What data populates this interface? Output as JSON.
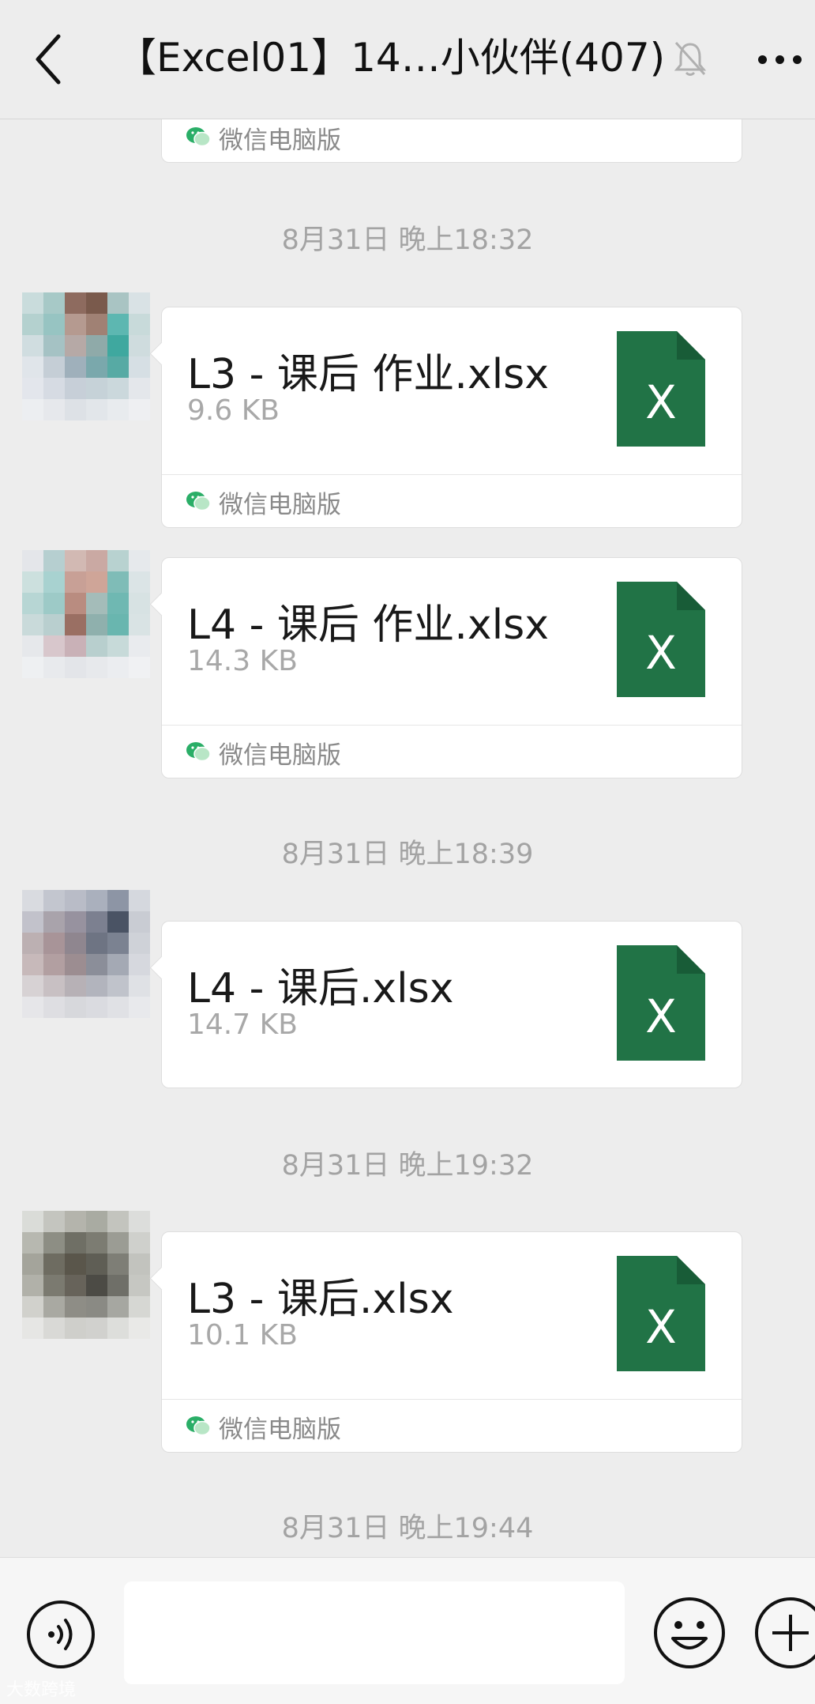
{
  "header": {
    "title": "【Excel01】14…小伙伴(407)",
    "back_icon": "chevron-left-icon",
    "mute_icon": "bell-muted-icon",
    "more_icon": "more-dots-icon"
  },
  "source_label": "微信电脑版",
  "messages": [
    {
      "time": "8月31日 晚上18:32",
      "file_name": "L3 - 课后 作业.xlsx",
      "file_size": "9.6 KB",
      "source": "微信电脑版"
    },
    {
      "file_name": "L4 - 课后 作业.xlsx",
      "file_size": "14.3 KB",
      "source": "微信电脑版"
    },
    {
      "time": "8月31日 晚上18:39",
      "file_name": "L4 - 课后.xlsx",
      "file_size": "14.7 KB"
    },
    {
      "time": "8月31日 晚上19:32",
      "file_name": "L3 - 课后.xlsx",
      "file_size": "10.1 KB",
      "source": "微信电脑版"
    }
  ],
  "last_time": "8月31日 晚上19:44",
  "file_icon_letter": "X",
  "input_bar": {
    "message_placeholder": "",
    "voice_icon": "voice-icon",
    "emoji_icon": "emoji-icon",
    "plus_icon": "plus-icon"
  },
  "watermark": "大数跨境",
  "colors": {
    "background": "#ededed",
    "excel_green": "#217346",
    "excel_fold": "#185c37",
    "wechat_green": "#2aae67"
  }
}
